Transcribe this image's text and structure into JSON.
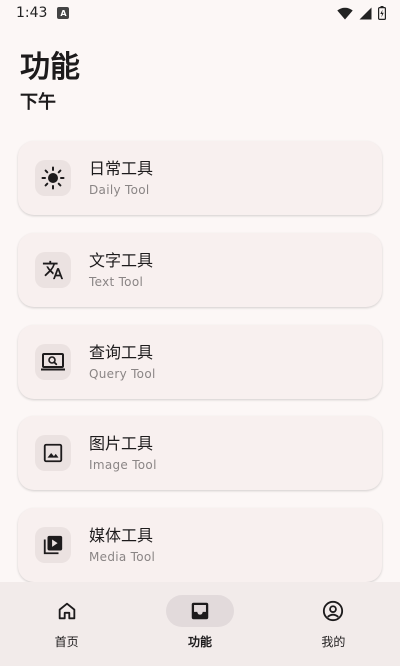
{
  "status_bar": {
    "time": "1:43",
    "notification_icon": "a-icon"
  },
  "header": {
    "title": "功能",
    "subtitle": "下午"
  },
  "cards": [
    {
      "title": "日常工具",
      "subtitle": "Daily Tool",
      "icon": "sun-icon"
    },
    {
      "title": "文字工具",
      "subtitle": "Text Tool",
      "icon": "translate-icon"
    },
    {
      "title": "查询工具",
      "subtitle": "Query Tool",
      "icon": "screen-search-icon"
    },
    {
      "title": "图片工具",
      "subtitle": "Image Tool",
      "icon": "image-icon"
    },
    {
      "title": "媒体工具",
      "subtitle": "Media Tool",
      "icon": "video-library-icon"
    }
  ],
  "bottom_nav": [
    {
      "label": "首页",
      "icon": "home-icon",
      "active": false
    },
    {
      "label": "功能",
      "icon": "inbox-icon",
      "active": true
    },
    {
      "label": "我的",
      "icon": "account-icon",
      "active": false
    }
  ],
  "colors": {
    "background": "#fcf7f6",
    "card": "#f8f0ef",
    "nav_bar": "#f2ebea",
    "active_pill": "#e2dadb"
  }
}
